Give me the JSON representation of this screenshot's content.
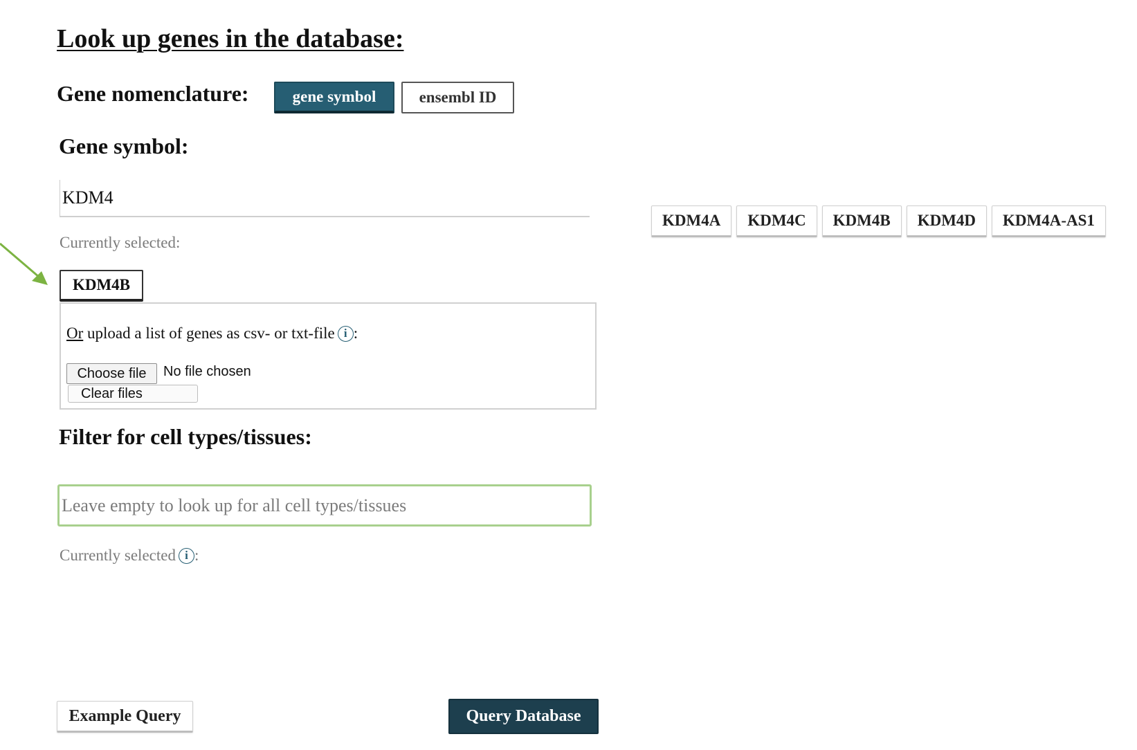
{
  "title": "Look up genes in the database:",
  "nomenclature": {
    "label": "Gene nomenclature:",
    "options": [
      "gene symbol",
      "ensembl ID"
    ],
    "active": "gene symbol"
  },
  "gene_symbol": {
    "label": "Gene symbol:",
    "input_value": "KDM4",
    "suggestions": [
      "KDM4A",
      "KDM4C",
      "KDM4B",
      "KDM4D",
      "KDM4A-AS1"
    ],
    "currently_selected_label": "Currently selected:",
    "selected": [
      "KDM4B"
    ]
  },
  "upload": {
    "or_text": "Or",
    "text": " upload a list of genes as csv- or txt-file",
    "info_icon": "i",
    "colon": ":",
    "choose_file": "Choose file",
    "no_file": "No file chosen",
    "clear_files": "Clear files"
  },
  "filter": {
    "label": "Filter for cell types/tissues:",
    "placeholder": "Leave empty to look up for all cell types/tissues",
    "input_value": "",
    "currently_selected_label": "Currently selected",
    "info_icon": "i",
    "colon": ":"
  },
  "actions": {
    "example": "Example Query",
    "query": "Query Database"
  },
  "colors": {
    "primary": "#265e73",
    "query_button": "#1d3f4e",
    "filter_border": "#a8d08d",
    "arrow": "#7cb342"
  }
}
